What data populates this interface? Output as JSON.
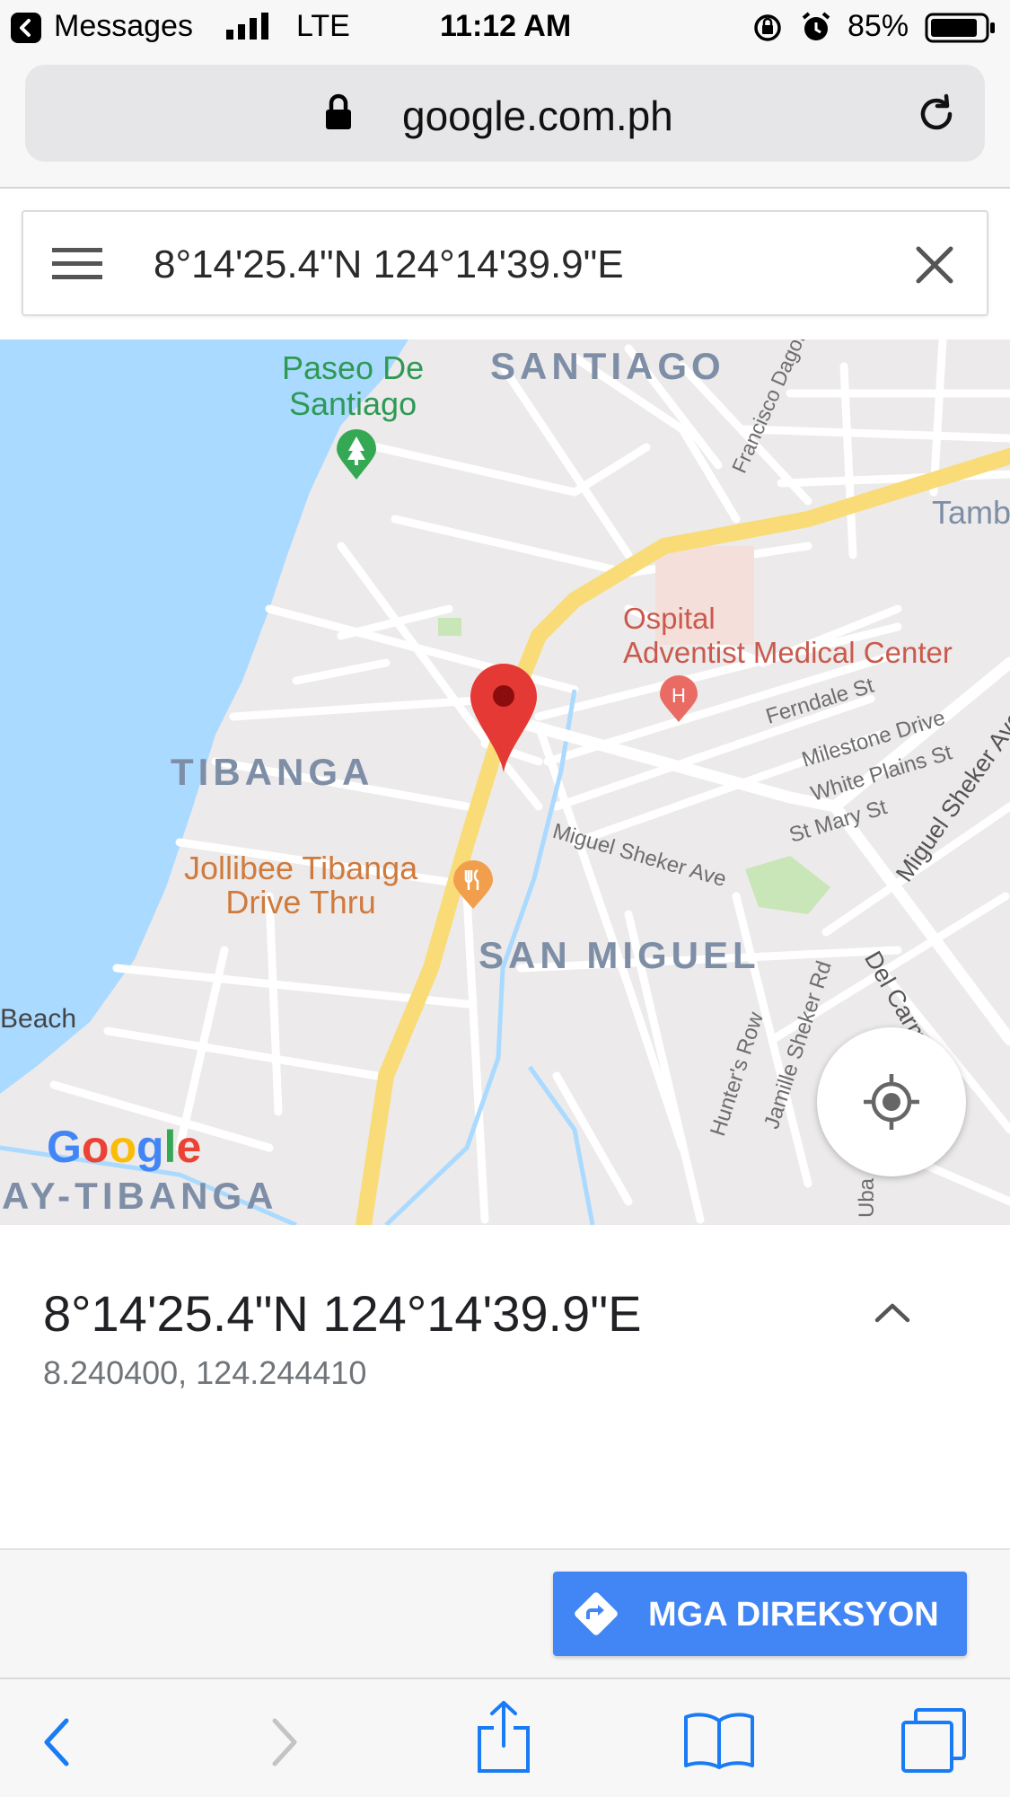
{
  "status_bar": {
    "back_app": "Messages",
    "network": "LTE",
    "time": "11:12 AM",
    "battery": "85%",
    "icons": [
      "signal-icon",
      "orientation-lock-icon",
      "alarm-icon",
      "battery-icon"
    ]
  },
  "browser": {
    "url": "google.com.ph",
    "icons": [
      "lock-icon",
      "reload-icon"
    ]
  },
  "search": {
    "query": "8°14'25.4\"N 124°14'39.9\"E",
    "icons": [
      "menu-icon",
      "clear-icon"
    ]
  },
  "map": {
    "areas": {
      "santiago": "SANTIAGO",
      "tibanga": "TIBANGA",
      "san_miguel": "SAN MIGUEL",
      "ay_tibanga": "AY-TIBANGA"
    },
    "places": {
      "paseo": "Paseo De\nSantiago",
      "ospital": "Ospital",
      "adventist": "Adventist Medical Center",
      "jollibee": "Jollibee Tibanga\nDrive Thru",
      "beach": "Beach",
      "tamb": "Tamb"
    },
    "streets": {
      "dagohoy": "Francisco Dagohoy St",
      "ferndale": "Ferndale St",
      "milestone": "Milestone Drive",
      "white_plains": "White Plains St",
      "st_mary": "St Mary St",
      "miguel_sheker_ave": "Miguel Sheker Ave",
      "miguel_sheker_ave_2": "Miguel Sheker Ave",
      "del_carmen": "Del Carmen Ave",
      "hunters_row": "Hunter's Row",
      "jamille": "Jamille Sheker Rd",
      "uba": "Uba"
    },
    "logo": "Google",
    "colors": {
      "water": "#aadaff",
      "land": "#eceaea",
      "major_road": "#f9dc77",
      "park": "#c8e6b8",
      "pin": "#e53935"
    },
    "icons": [
      "location-pin-icon",
      "hospital-icon",
      "restaurant-icon",
      "park-icon",
      "my-location-icon"
    ]
  },
  "info": {
    "title": "8°14'25.4\"N 124°14'39.9\"E",
    "decimal": "8.240400, 124.244410",
    "icons": [
      "chevron-up-icon"
    ]
  },
  "actions": {
    "directions_label": "MGA DIREKSYON",
    "accent": "#4285f4",
    "icons": [
      "directions-icon"
    ]
  },
  "toolbar": {
    "icons": [
      "back-icon",
      "forward-icon",
      "share-icon",
      "bookmarks-icon",
      "tabs-icon"
    ],
    "accent": "#1a7cf5"
  }
}
